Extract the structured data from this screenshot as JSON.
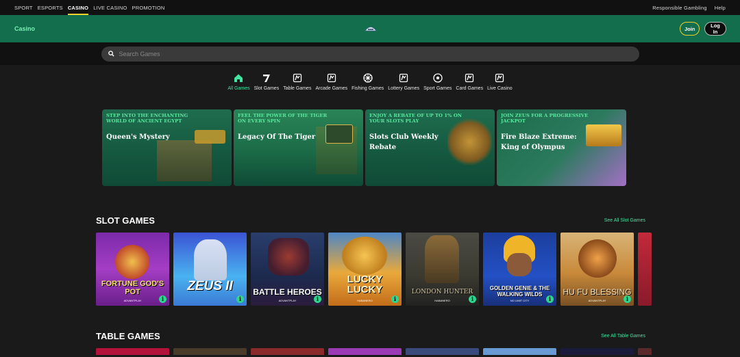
{
  "topnav": {
    "left": [
      "SPORT",
      "ESPORTS",
      "CASINO",
      "LIVE CASINO",
      "PROMOTION"
    ],
    "active": "CASINO",
    "right": [
      "Responsible Gambling",
      "Help"
    ]
  },
  "header": {
    "title": "Casino",
    "join": "Join",
    "login": "Log In"
  },
  "search": {
    "placeholder": "Search Games"
  },
  "categories": [
    {
      "label": "All Games",
      "icon": "home-icon",
      "active": true
    },
    {
      "label": "Slot Games",
      "icon": "seven-icon"
    },
    {
      "label": "Table Games",
      "icon": "cards-icon"
    },
    {
      "label": "Arcade Games",
      "icon": "cards-icon"
    },
    {
      "label": "Fishing Games",
      "icon": "wheel-icon"
    },
    {
      "label": "Lottery Games",
      "icon": "cards-icon"
    },
    {
      "label": "Sport Games",
      "icon": "ball-icon"
    },
    {
      "label": "Card Games",
      "icon": "cards-icon"
    },
    {
      "label": "Live Casino",
      "icon": "cards-icon"
    }
  ],
  "banners": [
    {
      "tag": "Step into the enchanting world of Ancient Egypt",
      "name": "Queen's Mystery"
    },
    {
      "tag": "Feel the power of the Tiger on every spin",
      "name": "Legacy Of The Tiger"
    },
    {
      "tag": "Enjoy a rebate of up to 1% on your slots play",
      "name": "Slots Club Weekly Rebate"
    },
    {
      "tag": "Join Zeus for a progressive jackpot",
      "name": "Fire Blaze Extreme: King of Olympus"
    }
  ],
  "slot_section": {
    "title": "SLOT GAMES",
    "see_all": "See All Slot Games"
  },
  "slot_games": [
    {
      "name": "FORTUNE GOD'S POT",
      "provider": "ADVANTPLAY"
    },
    {
      "name": "ZEUS II",
      "provider": ""
    },
    {
      "name": "BATTLE HEROES",
      "provider": "ADVANTPLAY"
    },
    {
      "name": "LUCKY LUCKY",
      "provider": "HABANERO"
    },
    {
      "name": "LONDON HUNTER",
      "provider": "HABANERO"
    },
    {
      "name": "GOLDEN GENIE & THE WALKING WILDS",
      "provider": "NO LIMIT CITY"
    },
    {
      "name": "HU FU BLESSING",
      "provider": "ADVANTPLAY"
    }
  ],
  "table_section": {
    "title": "TABLE GAMES",
    "see_all": "See All Table Games"
  }
}
